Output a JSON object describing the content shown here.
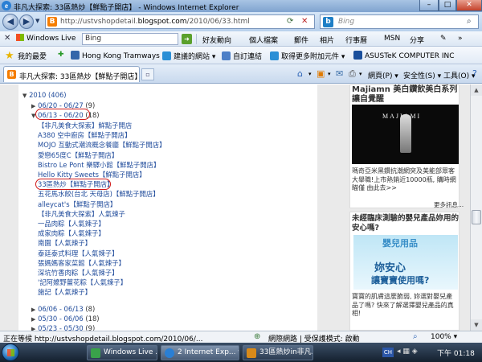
{
  "window": {
    "title": "非凡大探索: 33區熱炒【鮮點子開店】 - Windows Internet Explorer",
    "min": "–",
    "max": "□",
    "close": "✕"
  },
  "address": {
    "url_prefix": "http://ustvshopdetail.",
    "url_host": "blogspot.com",
    "url_suffix": "/2010/06/33.html",
    "refresh": "⟳",
    "stop": "✕",
    "search_placeholder": "Bing"
  },
  "wl_toolbar": {
    "logo": "Windows Live",
    "search_value": "Bing",
    "items": [
      "好友動向",
      "個人檔案",
      "郵件",
      "相片",
      "行事曆",
      "MSN",
      "分享"
    ]
  },
  "favorites": {
    "label": "我的最愛",
    "items": [
      {
        "label": "Hong Kong Tramways",
        "color": "#3366aa"
      },
      {
        "label": "建議的網站 ▾",
        "color": "#2b8fd6"
      },
      {
        "label": "自訂連結",
        "color": "#4c7fc7"
      },
      {
        "label": "取得更多附加元件 ▾",
        "color": "#2b8fd6"
      },
      {
        "label": "ASUSTeK COMPUTER INC",
        "color": "#1a4f9c"
      }
    ]
  },
  "tab": {
    "label": "非凡大探索: 33區熱炒【鮮點子開店】",
    "commands": [
      "網頁(P) ▾",
      "安全性(S) ▾",
      "工具(O) ▾"
    ]
  },
  "archive": {
    "year": "2010 (406)",
    "weeks": [
      {
        "label": "06/20 - 06/27",
        "count": "(9)",
        "expanded": false
      },
      {
        "label": "06/13 - 06/20",
        "count": "(18)",
        "expanded": true
      }
    ],
    "posts": [
      "【非凡美食大探索】鮮點子開店",
      "A380 空中廚房【鮮點子開店】",
      "MOJO 互動式潮流概念餐廳【鮮點子開店】",
      "愛戀65度C【鮮點子開店】",
      "Bistro Le Pont 樂驛小館【鮮點子開店】",
      "Hello Kitty Sweets【鮮點子開店】",
      "33區熱炒【鮮點子開店】",
      "五花馬水餃(台北 天母店)【鮮點子開店】",
      "alleycat's【鮮點子開店】",
      "【非凡美食大探索】人氣辣子",
      "一品肉粽【人氣辣子】",
      "成家肉粽【人氣辣子】",
      "南園【人氣辣子】",
      "泰廷泰式料理【人氣辣子】",
      "張媽媽客家菜館【人氣辣子】",
      "深坑竹香肉粽【人氣辣子】",
      "'記阿嬤野薑花粽【人氣辣子】",
      "施記【人氣辣子】"
    ],
    "older": [
      {
        "label": "06/06 - 06/13",
        "count": "(8)"
      },
      {
        "label": "05/30 - 06/06",
        "count": "(18)"
      },
      {
        "label": "05/23 - 05/30",
        "count": "(9)"
      }
    ]
  },
  "ads": {
    "ad1": {
      "headline": "Majiamn 美白鑽飲美白系列 讓自覺醒",
      "brand": "MAJIAMI",
      "body": "瑪奇亞米黑鑽抗潮網突及美能部眾客大舉職!上市熱銷近10000瓶, 購時網瞄僅 由此去>>",
      "more": "更多訊息..."
    },
    "ad2": {
      "headline": "未經臨床測驗的嬰兒產品妳用的安心嗎?",
      "brand": "嬰兒用品",
      "line1": "妳安心",
      "line2": "讓寶寶使用嗎?",
      "body": "寶寶的肌膚這麼脆弱, 妳選對嬰兒產品了嗎? 快來了解選擇嬰兒產品的真相!"
    }
  },
  "status": {
    "text": "正在等候 http://ustvshopdetail.blogspot.com/2010/06/...",
    "network": "網際網路 | 受保護模式: 啟動",
    "zoom": "100% ▾"
  },
  "taskbar": {
    "items": [
      "Windows Live ...",
      "2 Internet Exp... ▾",
      "33區熱炒in非凡..."
    ],
    "lang": "CH",
    "clock": "下午 01:18"
  }
}
